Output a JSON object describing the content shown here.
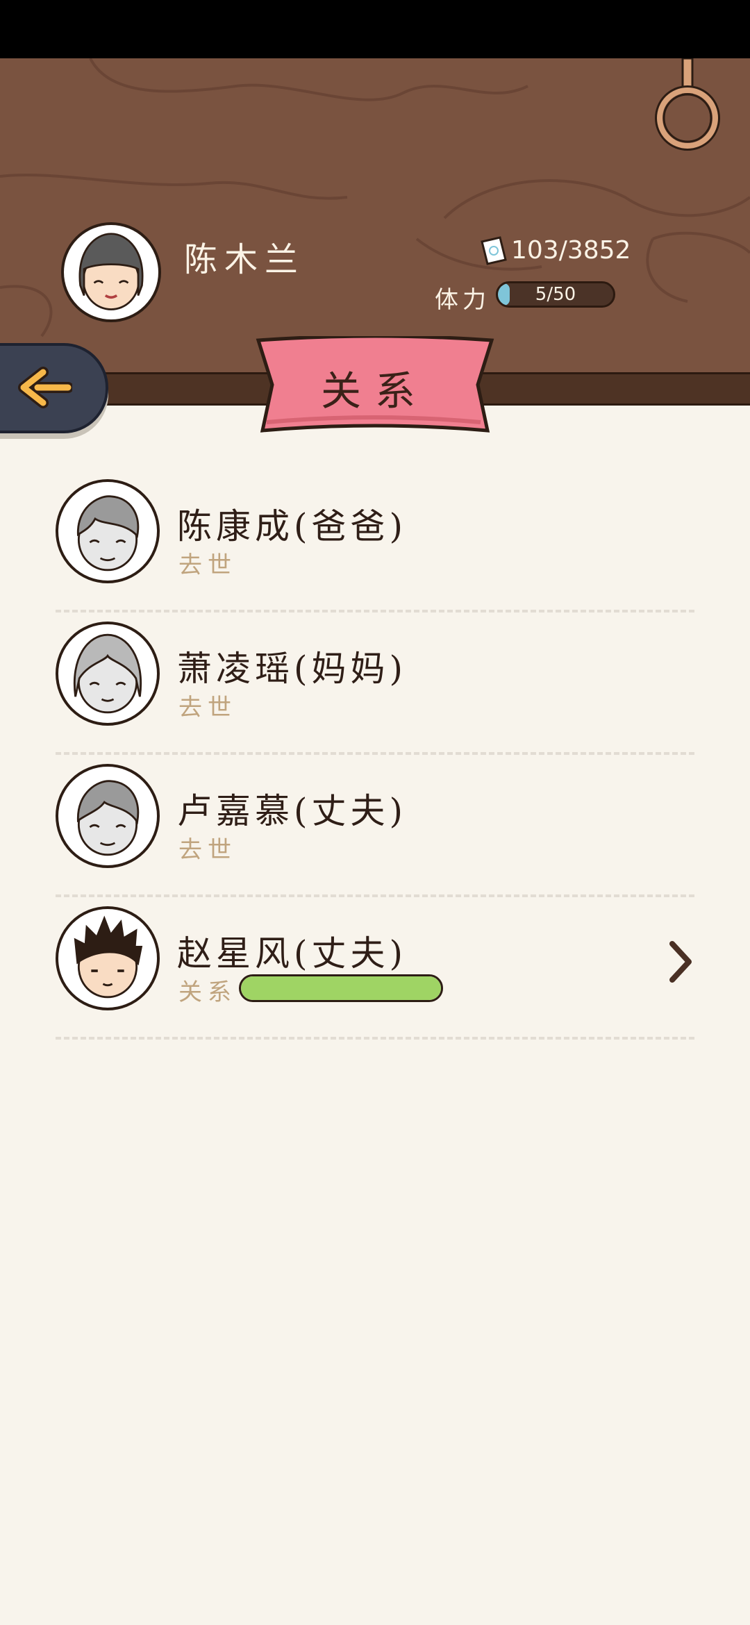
{
  "player": {
    "name": "陈木兰",
    "money": "103/3852",
    "stamina_label": "体力",
    "stamina_text": "5/50",
    "stamina_fraction": 0.1
  },
  "page": {
    "title": "关系"
  },
  "relations": [
    {
      "name": "陈康成(爸爸)",
      "status": "去世",
      "deceased": true
    },
    {
      "name": "萧凌瑶(妈妈)",
      "status": "去世",
      "deceased": true
    },
    {
      "name": "卢嘉慕(丈夫)",
      "status": "去世",
      "deceased": true
    },
    {
      "name": "赵星风(丈夫)",
      "status": "关系",
      "deceased": false,
      "relationship_fraction": 1.0
    }
  ],
  "colors": {
    "wood": "#7a5340",
    "ribbon": "#f07f90",
    "relationship_bar": "#9fd464",
    "stamina_bar": "#7fc5d9",
    "background": "#f8f4ec"
  },
  "icons": [
    "back-arrow-icon",
    "money-note-icon",
    "hanging-ring-icon",
    "chevron-right-icon"
  ]
}
